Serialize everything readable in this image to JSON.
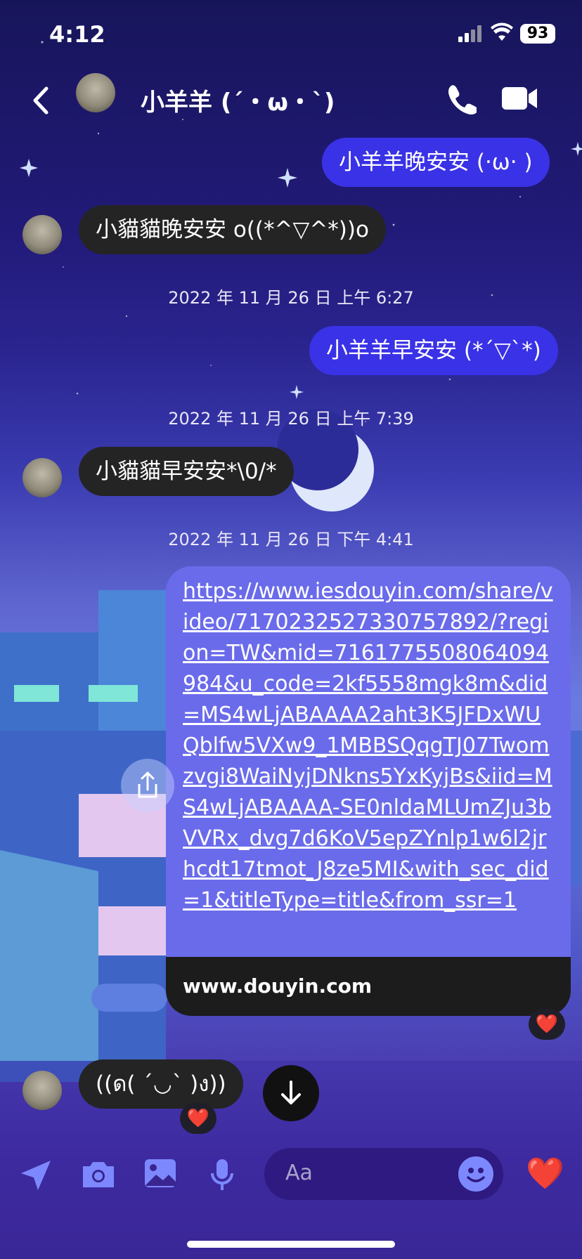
{
  "status": {
    "time": "4:12",
    "battery": "93"
  },
  "header": {
    "name": "小羊羊 (´・ω・`)"
  },
  "messages": [
    {
      "text": "小羊羊晚安安 (·ω· )",
      "side": "out"
    },
    {
      "text": "小貓貓晚安安 o((*^▽^*))o",
      "side": "in"
    },
    {
      "timestamp": "2022 年 11 月 26 日 上午 6:27"
    },
    {
      "text": "小羊羊早安安 (*´▽`*)",
      "side": "out"
    },
    {
      "timestamp": "2022 年 11 月 26 日 上午 7:39"
    },
    {
      "text": "小貓貓早安安*\\0/*",
      "side": "in"
    },
    {
      "timestamp": "2022 年 11 月 26 日 下午 4:41"
    },
    {
      "text": "((ด( ´◡` )ง))",
      "side": "in"
    }
  ],
  "link": {
    "url": "https://www.iesdouyin.com/share/video/7170232527330757892/?region=TW&mid=7161775508064094984&u_code=2kf5558mgk8m&did=MS4wLjABAAAA2aht3K5JFDxWUQblfw5VXw9_1MBBSQqgTJ07Twomzvgi8WaiNyjDNkns5YxKyjBs&iid=MS4wLjABAAAA-SE0nldaMLUmZJu3bVVRx_dvg7d6KoV5epZYnlp1w6l2jrhcdt17tmot_J8ze5MI&with_sec_did=1&titleType=title&from_ssr=1",
    "domain": "www.douyin.com"
  },
  "reaction_emoji": "❤️",
  "composer": {
    "placeholder": "Aa",
    "heart": "❤️"
  },
  "colors": {
    "out_bubble": "#3a32e6",
    "in_bubble": "#242424",
    "link_bubble": "#6a6bea"
  }
}
